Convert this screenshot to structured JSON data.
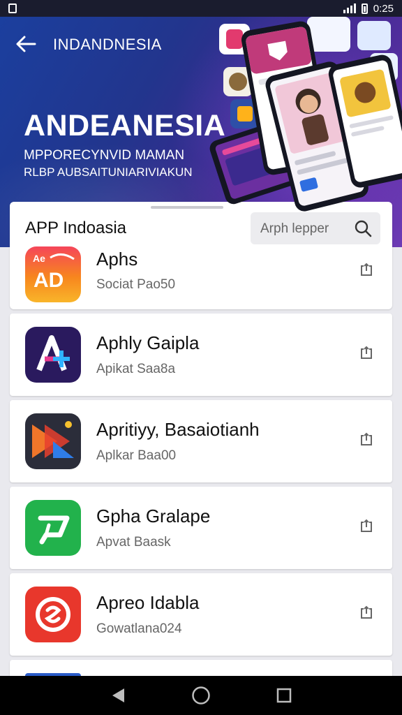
{
  "status_bar": {
    "time": "0:25"
  },
  "header": {
    "brand": "INDANDNESIA",
    "title": "ANDEANESIA",
    "subtitle_1": "MPPORECYNVID MAMAN",
    "subtitle_2": "RLBP AUBSAITUNIARIVIAKUN"
  },
  "list": {
    "title": "APP Indoasia",
    "search_placeholder": "Arph lepper",
    "apps": [
      {
        "name": "Aphs",
        "subtitle": "Sociat Pao50",
        "icon": "ad-icon"
      },
      {
        "name": "Aphly Gaipla",
        "subtitle": "Apikat Saa8a",
        "icon": "a-plus-icon"
      },
      {
        "name": "Apritiyy, Basaiotianh",
        "subtitle": "Aplkar Baa00",
        "icon": "play-arrow-icon"
      },
      {
        "name": "Gpha Gralape",
        "subtitle": "Apvat Baask",
        "icon": "cart-icon"
      },
      {
        "name": "Apreo Idabla",
        "subtitle": "Gowatlana024",
        "icon": "swirl-icon"
      }
    ]
  },
  "colors": {
    "banner_start": "#1b3f9e",
    "banner_end": "#6d3bb5",
    "icon_orange": "#f59a1c",
    "icon_navy": "#2a1a5e",
    "icon_green": "#22b24c",
    "icon_red": "#e8372c"
  }
}
